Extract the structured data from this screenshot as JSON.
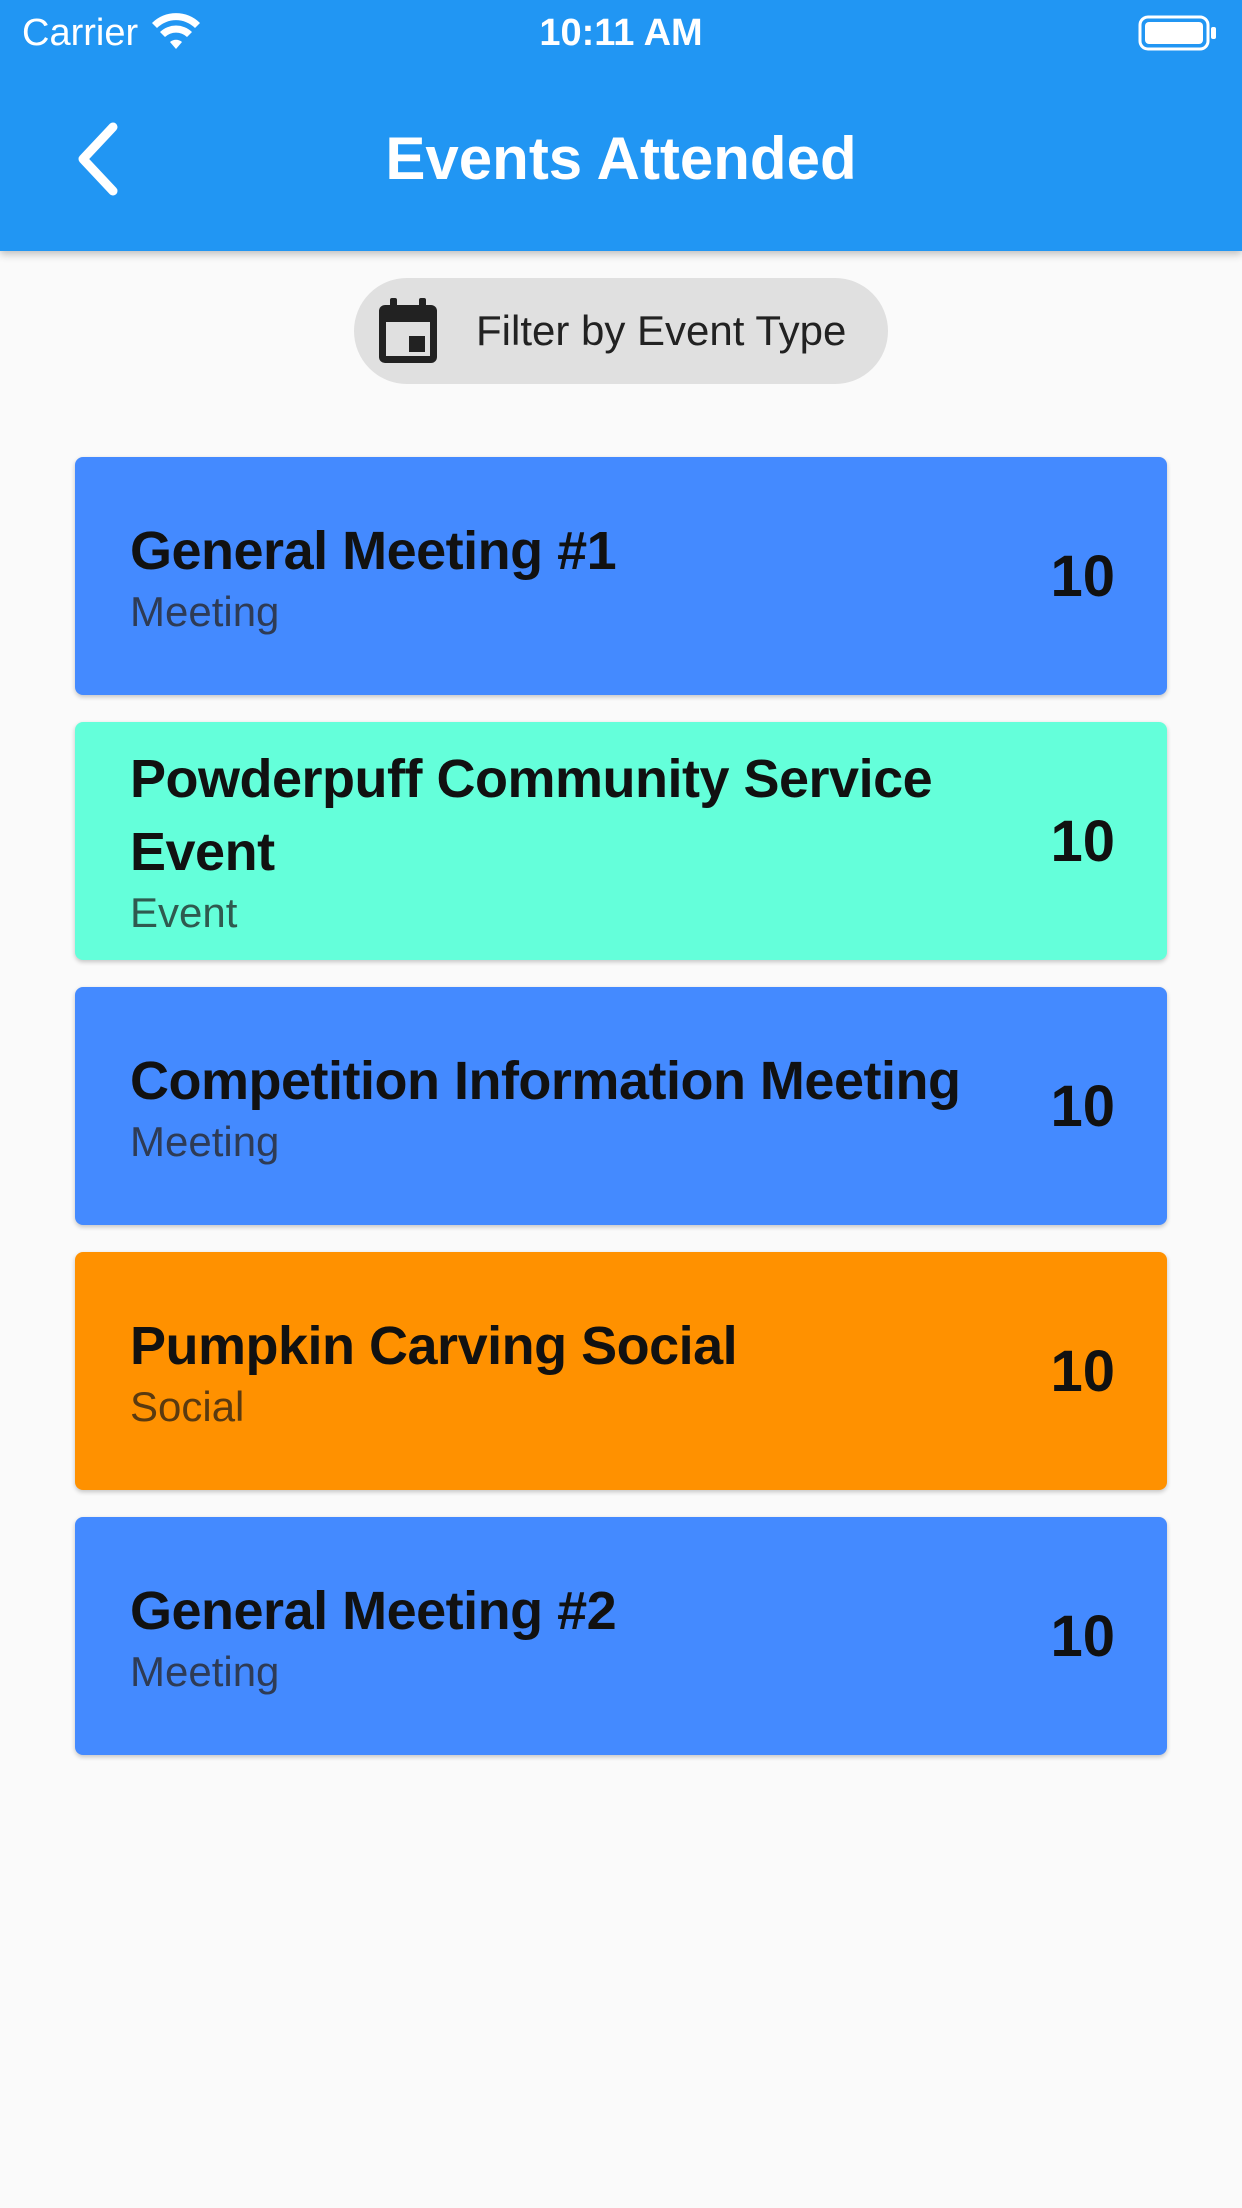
{
  "status_bar": {
    "carrier": "Carrier",
    "time": "10:11 AM",
    "icons": [
      "wifi-icon",
      "battery-icon"
    ]
  },
  "header": {
    "title": "Events Attended",
    "back_icon": "chevron-left-icon",
    "background_color": "#2196F3"
  },
  "filter": {
    "label": "Filter by Event Type",
    "icon": "calendar-icon",
    "background_color": "#E0E0E0"
  },
  "events": [
    {
      "name": "General Meeting #1",
      "type": "Meeting",
      "points": "10",
      "color": "#448AFF"
    },
    {
      "name": "Powderpuff Community Service Event",
      "type": "Event",
      "points": "10",
      "color": "#64FFDA"
    },
    {
      "name": "Competition Information Meeting",
      "type": "Meeting",
      "points": "10",
      "color": "#448AFF"
    },
    {
      "name": "Pumpkin Carving Social",
      "type": "Social",
      "points": "10",
      "color": "#FF9100"
    },
    {
      "name": "General Meeting #2",
      "type": "Meeting",
      "points": "10",
      "color": "#448AFF"
    }
  ]
}
